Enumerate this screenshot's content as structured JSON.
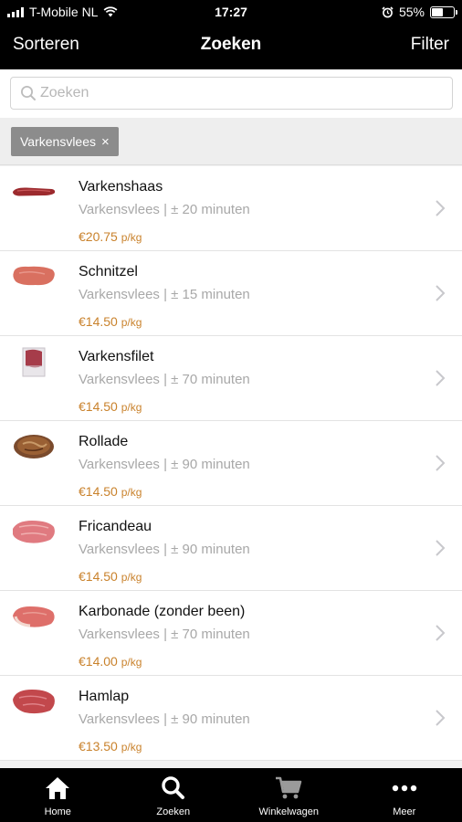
{
  "status_bar": {
    "carrier": "T-Mobile NL",
    "time": "17:27",
    "battery": "55%",
    "battery_level": 0.55
  },
  "nav": {
    "left": "Sorteren",
    "title": "Zoeken",
    "right": "Filter"
  },
  "search": {
    "placeholder": "Zoeken",
    "value": ""
  },
  "filter_chip": {
    "label": "Varkensvlees",
    "remove": "×"
  },
  "colors": {
    "price": "#c9822c",
    "meta": "#a8a8a8",
    "chip": "#8c8c8c",
    "bar": "#000000"
  },
  "items": [
    {
      "name": "Varkenshaas",
      "meta": "Varkensvlees | ± 20 minuten",
      "price": "€20.75",
      "unit": "p/kg"
    },
    {
      "name": "Schnitzel",
      "meta": "Varkensvlees | ± 15 minuten",
      "price": "€14.50",
      "unit": "p/kg"
    },
    {
      "name": "Varkensfilet",
      "meta": "Varkensvlees | ± 70 minuten",
      "price": "€14.50",
      "unit": "p/kg"
    },
    {
      "name": "Rollade",
      "meta": "Varkensvlees | ± 90 minuten",
      "price": "€14.50",
      "unit": "p/kg"
    },
    {
      "name": "Fricandeau",
      "meta": "Varkensvlees | ± 90 minuten",
      "price": "€14.50",
      "unit": "p/kg"
    },
    {
      "name": "Karbonade (zonder been)",
      "meta": "Varkensvlees | ± 70 minuten",
      "price": "€14.00",
      "unit": "p/kg"
    },
    {
      "name": "Hamlap",
      "meta": "Varkensvlees | ± 90 minuten",
      "price": "€13.50",
      "unit": "p/kg"
    }
  ],
  "tabs": [
    {
      "label": "Home",
      "icon": "home-icon"
    },
    {
      "label": "Zoeken",
      "icon": "search-icon"
    },
    {
      "label": "Winkelwagen",
      "icon": "cart-icon"
    },
    {
      "label": "Meer",
      "icon": "more-icon"
    }
  ]
}
